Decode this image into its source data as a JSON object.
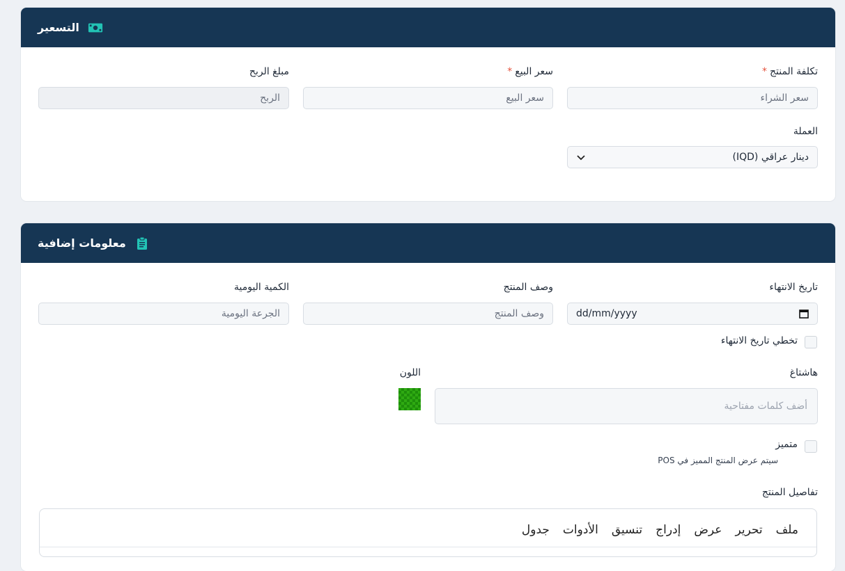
{
  "pricing": {
    "title": "التسعير",
    "icon": "money-bill-icon",
    "cost_label": "تكلفة المنتج",
    "cost_placeholder": "سعر الشراء",
    "sell_label": "سعر البيع",
    "sell_placeholder": "سعر البيع",
    "profit_label": "مبلغ الربح",
    "profit_placeholder": "الربح",
    "currency_label": "العملة",
    "currency_value": "دينار عراقي (IQD)",
    "required_mark": "*"
  },
  "extra": {
    "title": "معلومات إضافية",
    "icon": "clipboard-icon",
    "expiry_label": "تاريخ الانتهاء",
    "expiry_value": "dd/mm/yyyy",
    "desc_label": "وصف المنتج",
    "desc_placeholder": "وصف المنتج",
    "daily_label": "الكمية اليومية",
    "daily_placeholder": "الجرعة اليومية",
    "skip_expiry_label": "تخطي تاريخ الانتهاء",
    "hashtag_label": "هاشتاغ",
    "hashtag_placeholder": "أضف كلمات مفتاحية",
    "color_label": "اللون",
    "featured_label": "متميز",
    "featured_hint": "سيتم عرض المنتج المميز في POS",
    "details_label": "تفاصيل المنتج",
    "editor_menu": [
      "ملف",
      "تحرير",
      "عرض",
      "إدراج",
      "تنسيق",
      "الأدوات",
      "جدول"
    ]
  },
  "colors": {
    "header_bg": "#163654",
    "accent_icon": "#22c3b5",
    "required": "#e5533d",
    "swatch": "#2eaa12"
  }
}
